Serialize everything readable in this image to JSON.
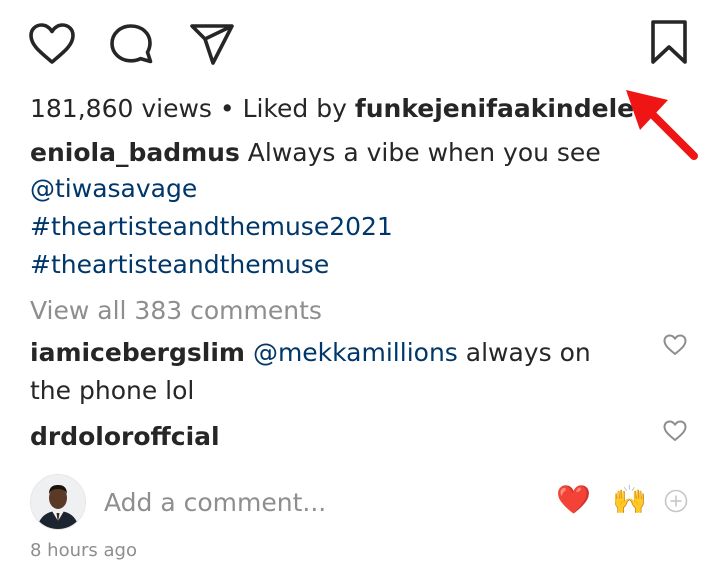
{
  "actions": {
    "like_icon": "heart-outline-icon",
    "comment_icon": "comment-bubble-icon",
    "share_icon": "paper-plane-icon",
    "save_icon": "bookmark-icon"
  },
  "stats": {
    "views": "181,860 views",
    "separator": " • ",
    "liked_by_prefix": "Liked by ",
    "liked_by_user": "funkejenifaakindele"
  },
  "caption": {
    "username": "eniola_badmus",
    "text": "Always a vibe when you see",
    "mention": "@tiwasavage",
    "hashtags": [
      "#theartisteandthemuse2021",
      "#theartisteandthemuse"
    ]
  },
  "view_all_comments": "View all 383 comments",
  "comments": [
    {
      "username": "iamicebergslim",
      "mention": "@mekkamillions",
      "text_line1": "always on",
      "text_line2": "the phone lol"
    },
    {
      "username": "drdoloroffcial",
      "username_display": "drdoloroffcial"
    }
  ],
  "add_comment": {
    "placeholder": "Add a comment...",
    "emoji_heart": "❤️",
    "emoji_hands": "🙌",
    "add_icon": "plus-circle-icon"
  },
  "timestamp": "8 hours ago",
  "colors": {
    "text": "#262626",
    "link": "#00376b",
    "muted": "#8e8e8e",
    "annotation_arrow": "#f01515"
  }
}
